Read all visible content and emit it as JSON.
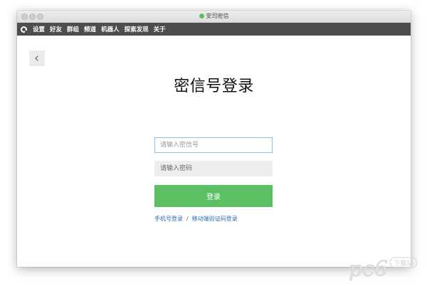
{
  "window": {
    "title": "安司密信"
  },
  "menu": {
    "items": [
      "设置",
      "好友",
      "群组",
      "频道",
      "机器人",
      "探索发现",
      "关于"
    ]
  },
  "login": {
    "title": "密信号登录",
    "account_placeholder": "请输入密信号",
    "password_placeholder": "请输入密码",
    "submit_label": "登录",
    "phone_login_link": "手机号登录",
    "separator": "/",
    "device_code_login_link": "移动端验证码登录"
  },
  "watermark": {
    "brand": "pc6",
    "subtext": "下载站"
  },
  "colors": {
    "menubar": "#4d4d4d",
    "accent_green": "#5bbf63",
    "link_blue": "#2b6cb0",
    "input_focus_border": "#8ec4ea"
  }
}
